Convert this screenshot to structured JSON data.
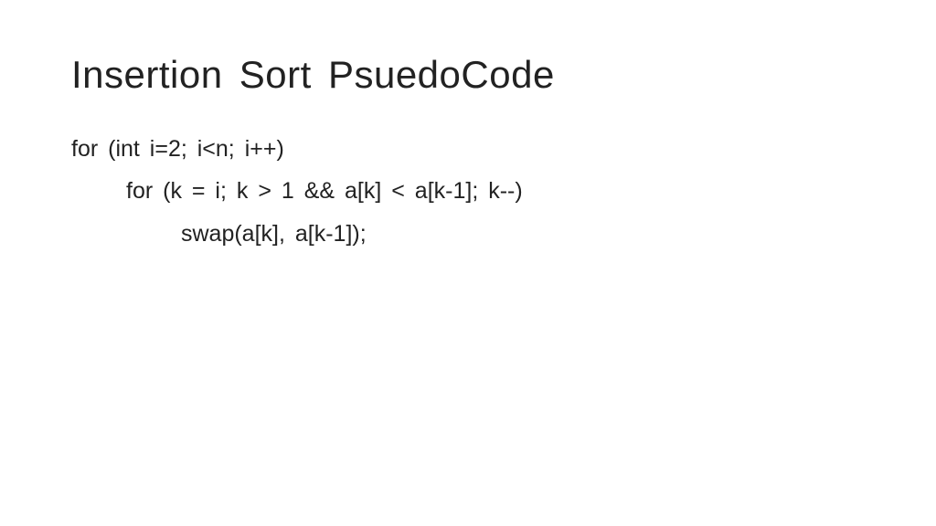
{
  "slide": {
    "title": "Insertion Sort PsuedoCode",
    "code": {
      "line1": "for (int i=2; i<n; i++)",
      "line2": "for (k = i; k > 1 && a[k] < a[k-1]; k--)",
      "line3": "swap(a[k], a[k-1]);"
    }
  }
}
